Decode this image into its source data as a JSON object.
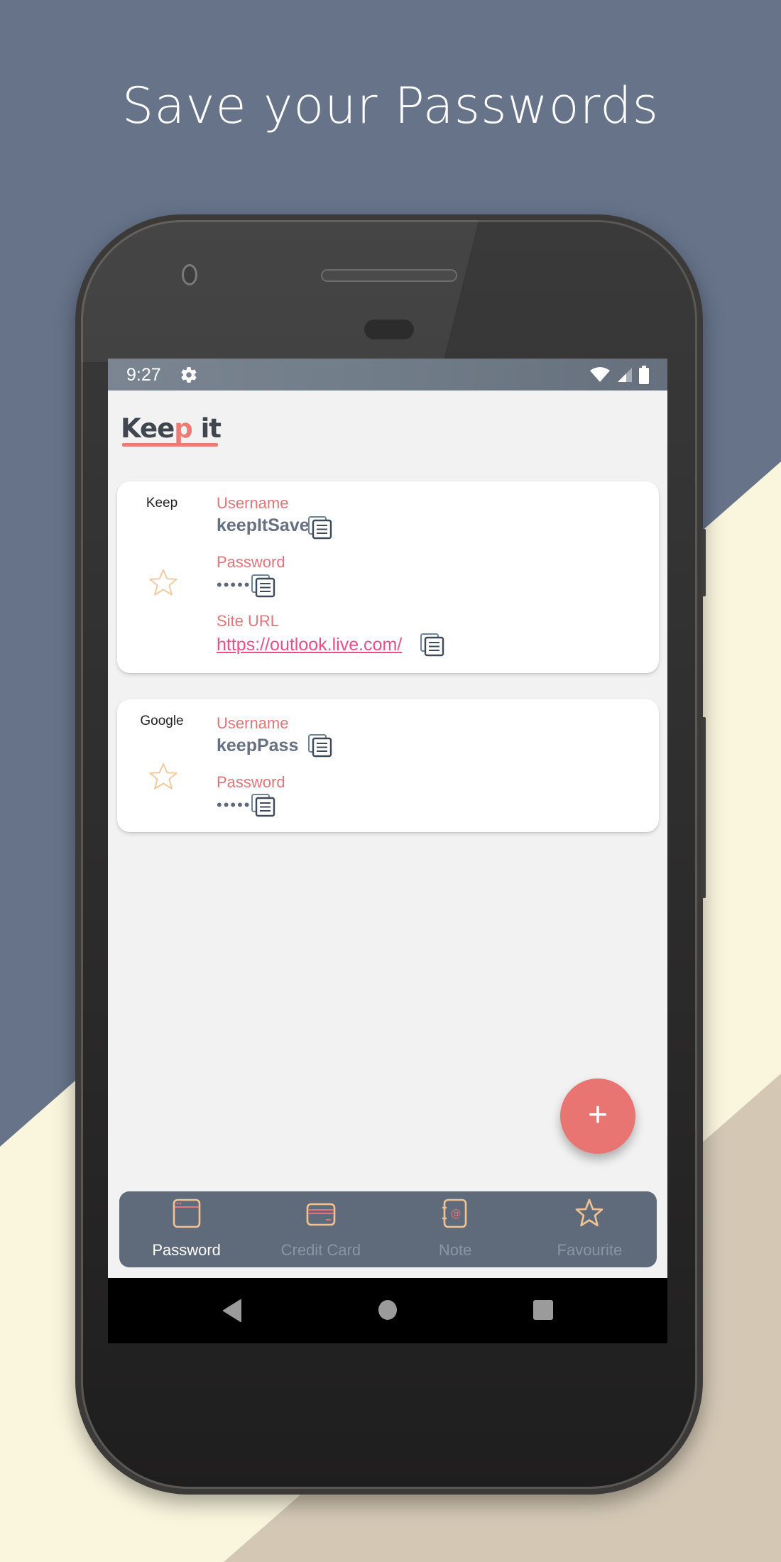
{
  "headline": "Save your Passwords",
  "colors": {
    "bg_slate": "#667389",
    "bg_cream": "#faf5dd",
    "bg_tan": "#d4c8b5",
    "accent": "#e87571",
    "label_pink": "#e0757a",
    "link_pink": "#ea4f86",
    "nav_bg": "#5f6b7a",
    "icon_peach": "#f3c293"
  },
  "status_bar": {
    "time": "9:27",
    "left_icons": [
      "settings-gear-icon"
    ],
    "right_icons": [
      "wifi-icon",
      "cell-signal-icon",
      "battery-icon"
    ]
  },
  "app": {
    "logo": {
      "text_part1": "Kee",
      "text_accent": "p",
      "text_part2": " it"
    }
  },
  "entries": [
    {
      "site": "Keep",
      "favourite": false,
      "fields": [
        {
          "label": "Username",
          "value": "keepItSave",
          "type": "text"
        },
        {
          "label": "Password",
          "value": "••••••",
          "type": "password"
        },
        {
          "label": "Site URL",
          "value": "https://outlook.live.com/",
          "type": "link"
        }
      ]
    },
    {
      "site": "Google",
      "favourite": false,
      "fields": [
        {
          "label": "Username",
          "value": "keepPass",
          "type": "text"
        },
        {
          "label": "Password",
          "value": "••••••",
          "type": "password"
        }
      ]
    }
  ],
  "fab": {
    "label": "+",
    "icon": "add-icon"
  },
  "bottom_nav": {
    "active_index": 0,
    "items": [
      {
        "label": "Password",
        "icon": "browser-window-icon"
      },
      {
        "label": "Credit Card",
        "icon": "credit-card-icon"
      },
      {
        "label": "Note",
        "icon": "address-book-icon"
      },
      {
        "label": "Favourite",
        "icon": "star-icon"
      }
    ]
  },
  "system_nav": {
    "buttons": [
      "back-icon",
      "home-icon",
      "recents-icon"
    ]
  }
}
